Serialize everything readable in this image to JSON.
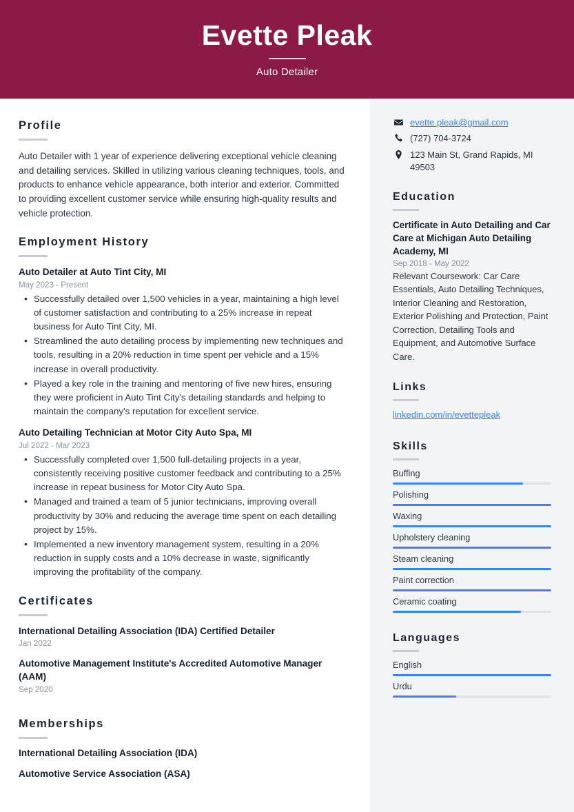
{
  "header": {
    "name": "Evette Pleak",
    "title": "Auto Detailer",
    "bg_color": "#8b1a47"
  },
  "main": {
    "profile": {
      "heading": "Profile",
      "text": "Auto Detailer with 1 year of experience delivering exceptional vehicle cleaning and detailing services. Skilled in utilizing various cleaning techniques, tools, and products to enhance vehicle appearance, both interior and exterior. Committed to providing excellent customer service while ensuring high-quality results and vehicle protection."
    },
    "employment": {
      "heading": "Employment History",
      "entries": [
        {
          "title": "Auto Detailer at Auto Tint City, MI",
          "date": "May 2023 - Present",
          "bullets": [
            "Successfully detailed over 1,500 vehicles in a year, maintaining a high level of customer satisfaction and contributing to a 25% increase in repeat business for Auto Tint City, MI.",
            "Streamlined the auto detailing process by implementing new techniques and tools, resulting in a 20% reduction in time spent per vehicle and a 15% increase in overall productivity.",
            "Played a key role in the training and mentoring of five new hires, ensuring they were proficient in Auto Tint City's detailing standards and helping to maintain the company's reputation for excellent service."
          ]
        },
        {
          "title": "Auto Detailing Technician at Motor City Auto Spa, MI",
          "date": "Jul 2022 - Mar 2023",
          "bullets": [
            "Successfully completed over 1,500 full-detailing projects in a year, consistently receiving positive customer feedback and contributing to a 25% increase in repeat business for Motor City Auto Spa.",
            "Managed and trained a team of 5 junior technicians, improving overall productivity by 30% and reducing the average time spent on each detailing project by 15%.",
            "Implemented a new inventory management system, resulting in a 20% reduction in supply costs and a 10% decrease in waste, significantly improving the profitability of the company."
          ]
        }
      ]
    },
    "certificates": {
      "heading": "Certificates",
      "items": [
        {
          "title": "International Detailing Association (IDA) Certified Detailer",
          "date": "Jan 2022"
        },
        {
          "title": "Automotive Management Institute's Accredited Automotive Manager (AAM)",
          "date": "Sep 2020"
        }
      ]
    },
    "memberships": {
      "heading": "Memberships",
      "items": [
        "International Detailing Association (IDA)",
        "Automotive Service Association (ASA)"
      ]
    }
  },
  "sidebar": {
    "contact": [
      {
        "icon": "envelope-icon",
        "text": "evette.pleak@gmail.com",
        "is_link": true
      },
      {
        "icon": "phone-icon",
        "text": "(727) 704-3724",
        "is_link": false
      },
      {
        "icon": "location-pin-icon",
        "text": "123 Main St, Grand Rapids, MI 49503",
        "is_link": false
      }
    ],
    "education": {
      "heading": "Education",
      "title": "Certificate in Auto Detailing and Car Care at Michigan Auto Detailing Academy, MI",
      "date": "Sep 2018 - May 2022",
      "description": "Relevant Coursework: Car Care Essentials, Auto Detailing Techniques, Interior Cleaning and Restoration, Exterior Polishing and Protection, Paint Correction, Detailing Tools and Equipment, and Automotive Surface Care."
    },
    "links": {
      "heading": "Links",
      "items": [
        "linkedin.com/in/evettepleak"
      ]
    },
    "skills": {
      "heading": "Skills",
      "accent_color": "#3b82f6",
      "items": [
        {
          "label": "Buffing",
          "level": 82
        },
        {
          "label": "Polishing",
          "level": 100
        },
        {
          "label": "Waxing",
          "level": 100
        },
        {
          "label": "Upholstery cleaning",
          "level": 100
        },
        {
          "label": "Steam cleaning",
          "level": 100
        },
        {
          "label": "Paint correction",
          "level": 100
        },
        {
          "label": "Ceramic coating",
          "level": 81
        }
      ]
    },
    "languages": {
      "heading": "Languages",
      "items": [
        {
          "label": "English",
          "level": 100
        },
        {
          "label": "Urdu",
          "level": 40
        }
      ]
    }
  }
}
